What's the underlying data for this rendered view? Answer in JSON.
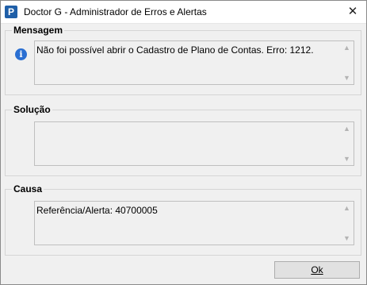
{
  "window": {
    "title": "Doctor G - Administrador de Erros e Alertas",
    "app_icon_letter": "P",
    "close_glyph": "✕"
  },
  "groups": {
    "mensagem": {
      "label": "Mensagem",
      "text": "Não foi possível abrir o Cadastro de Plano de Contas. Erro: 1212.",
      "icon": "info-icon"
    },
    "solucao": {
      "label": "Solução",
      "text": ""
    },
    "causa": {
      "label": "Causa",
      "text": "Referência/Alerta: 40700005"
    }
  },
  "buttons": {
    "ok_label": "Ok"
  }
}
